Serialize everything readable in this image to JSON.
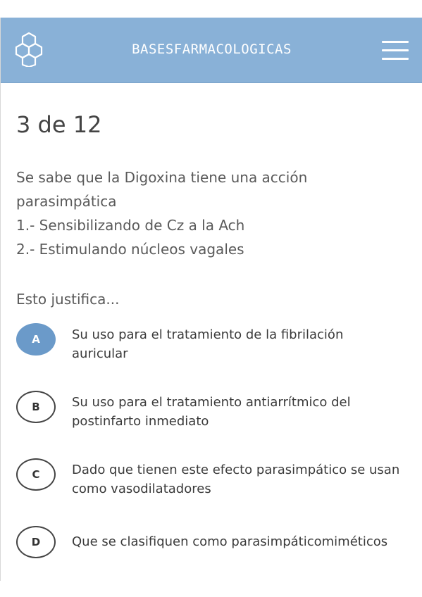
{
  "header": {
    "brand": "BASESFARMACOLOGICAS",
    "logo_icon": "hexagon-molecule-icon",
    "menu_icon": "hamburger-menu-icon",
    "background_color": "#89b1d7"
  },
  "quiz": {
    "counter": "3 de 12",
    "question_lines": [
      "Se sabe que la Digoxina tiene una acción",
      "parasimpática",
      "1.- Sensibilizando de Cz a la Ach",
      "2.- Estimulando núcleos vagales"
    ],
    "prompt": "Esto justifica...",
    "options": [
      {
        "letter": "A",
        "text": "Su uso para el tratamiento de la fibrilación auricular",
        "selected": true
      },
      {
        "letter": "B",
        "text": "Su uso para el tratamiento antiarrítmico del postinfarto inmediato",
        "selected": false
      },
      {
        "letter": "C",
        "text": "Dado que tienen este efecto parasimpático se usan como vasodilatadores",
        "selected": false
      },
      {
        "letter": "D",
        "text": "Que se clasifiquen como parasimpáticomiméticos",
        "selected": false
      }
    ],
    "selected_color": "#6b9ac9"
  }
}
